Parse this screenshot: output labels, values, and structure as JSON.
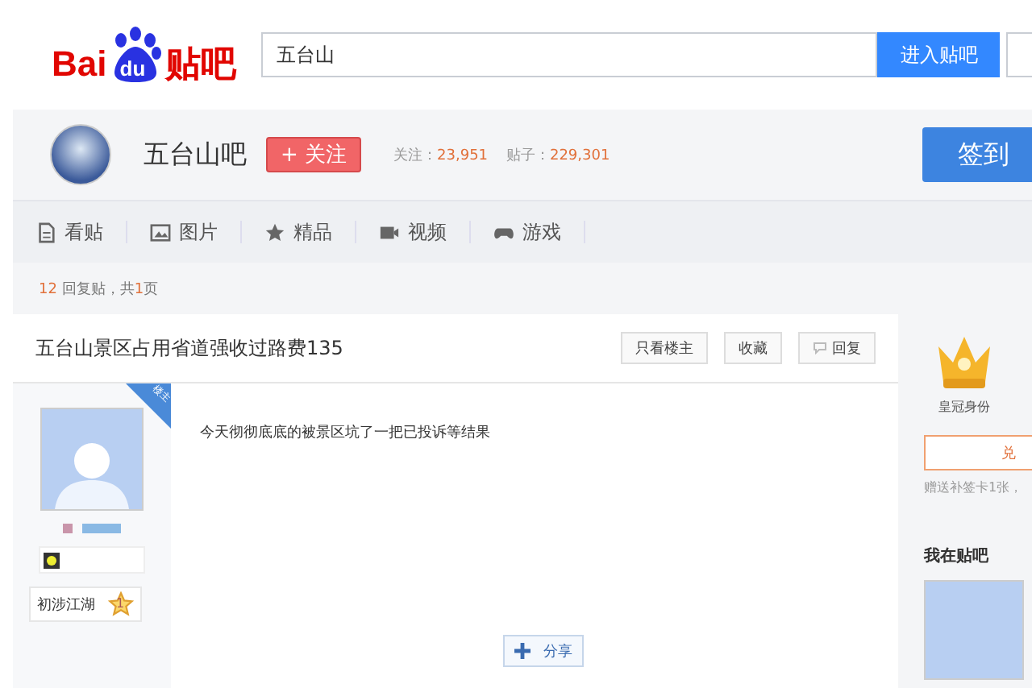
{
  "logo": {
    "part_1": "Bai",
    "part_2": "du",
    "part_3": "贴吧"
  },
  "search": {
    "value": "五台山",
    "button": "进入贴吧"
  },
  "forum": {
    "name": "五台山吧",
    "follow_button": "+ 关注",
    "followers_label": "关注：",
    "followers": "23,951",
    "posts_label": "贴子：",
    "posts": "229,301",
    "signin_button": "签到"
  },
  "nav": [
    {
      "kind": "posts",
      "label": "看贴"
    },
    {
      "kind": "images",
      "label": "图片"
    },
    {
      "kind": "featured",
      "label": "精品"
    },
    {
      "kind": "video",
      "label": "视频"
    },
    {
      "kind": "games",
      "label": "游戏"
    }
  ],
  "thread_meta": {
    "replies": "12",
    "replies_text": "回复贴，共",
    "pages": "1",
    "pages_text": "页"
  },
  "thread": {
    "title": "五台山景区占用省道强收过路费135",
    "actions": [
      "只看楼主",
      "收藏",
      "回复"
    ]
  },
  "post": {
    "ribbon": "楼主",
    "rank": "初涉江湖",
    "level": "1",
    "content": "今天彻彻底底的被景区坑了一把已投诉等结果",
    "share_button": "分享"
  },
  "sidebar": {
    "crown_label": "皇冠身份",
    "redeem_button": "兑",
    "note": "赠送补签卡1张，",
    "section_title": "我在贴吧"
  }
}
